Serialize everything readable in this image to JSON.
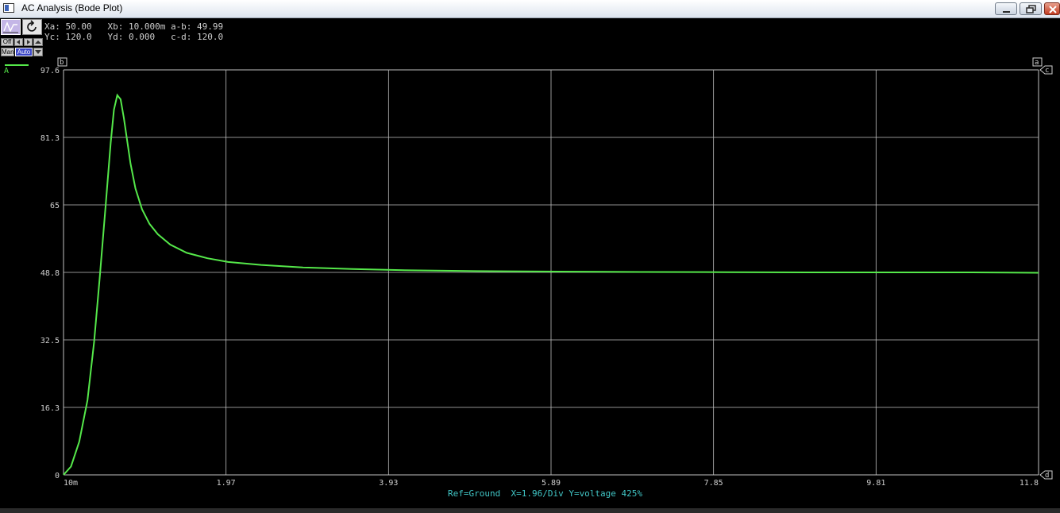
{
  "window": {
    "title": "AC Analysis (Bode Plot)"
  },
  "readouts": {
    "line1": "Xa: 50.00   Xb: 10.000m a-b: 49.99",
    "line2": "Yc: 120.0   Yd: 0.000   c-d: 120.0"
  },
  "toolbar": {
    "off_label": "Off",
    "man_label": "Man",
    "auto_label": "Auto"
  },
  "legend": {
    "series_label": "A"
  },
  "markers": {
    "a": "a",
    "b": "b",
    "c": "c",
    "d": "d"
  },
  "status_text": "Ref=Ground  X=1.96/Div Y=voltage 425%",
  "colors": {
    "trace": "#55e84a",
    "grid": "#bfbfbf",
    "status": "#41c6c6"
  },
  "chart_data": {
    "type": "line",
    "x_tick_labels": [
      "10m",
      "1.97",
      "3.93",
      "5.89",
      "7.85",
      "9.81",
      "11.8"
    ],
    "y_tick_labels": [
      "0",
      "16.3",
      "32.5",
      "48.8",
      "65",
      "81.3",
      "97.6"
    ],
    "xlim": [
      0.01,
      11.8
    ],
    "ylim": [
      0,
      97.6
    ],
    "grid": true,
    "series": [
      {
        "name": "A",
        "x": [
          0.01,
          0.1,
          0.2,
          0.3,
          0.38,
          0.45,
          0.52,
          0.58,
          0.62,
          0.66,
          0.7,
          0.74,
          0.78,
          0.82,
          0.88,
          0.96,
          1.05,
          1.15,
          1.3,
          1.5,
          1.75,
          2.0,
          2.4,
          2.9,
          3.5,
          4.2,
          5.0,
          6.0,
          7.0,
          8.0,
          9.0,
          10.0,
          11.0,
          11.8
        ],
        "y": [
          0,
          2,
          8,
          18,
          32,
          48,
          65,
          80,
          88,
          91.5,
          90.5,
          86,
          80.5,
          75,
          69,
          64,
          60.5,
          58,
          55.5,
          53.5,
          52.2,
          51.3,
          50.6,
          50.0,
          49.6,
          49.3,
          49.1,
          49.0,
          48.9,
          48.85,
          48.8,
          48.8,
          48.8,
          48.7
        ]
      }
    ]
  }
}
